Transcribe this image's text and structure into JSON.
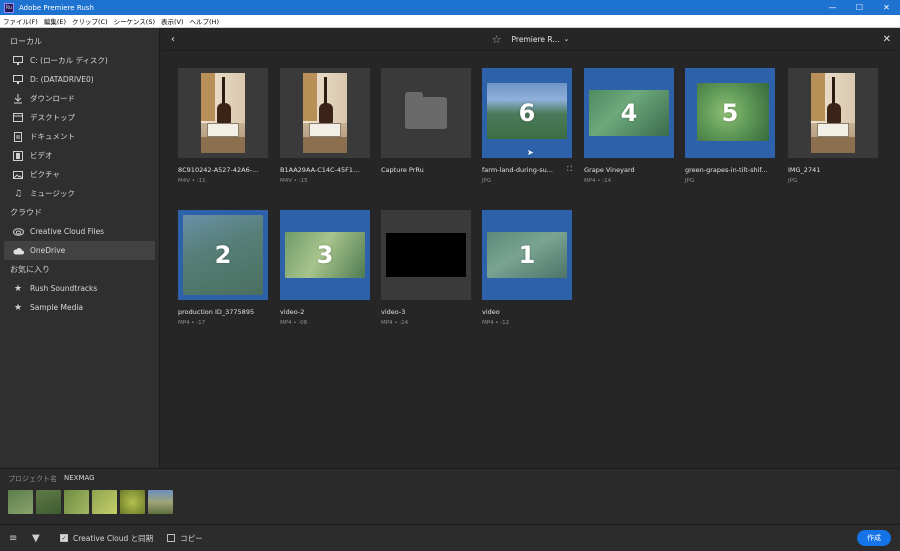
{
  "window": {
    "title": "Adobe Premiere Rush",
    "icon_text": "Ru",
    "controls": [
      "—",
      "☐",
      "✕"
    ]
  },
  "menubar": [
    "ファイル(F)",
    "編集(E)",
    "クリップ(C)",
    "シーケンス(S)",
    "表示(V)",
    "ヘルプ(H)"
  ],
  "sidebar": {
    "sections": [
      {
        "title": "ローカル",
        "items": [
          {
            "label": "C: (ローカル ディスク)",
            "icon": "monitor-icon"
          },
          {
            "label": "D: (DATADRIVE0)",
            "icon": "monitor-icon"
          },
          {
            "label": "ダウンロード",
            "icon": "download-icon"
          },
          {
            "label": "デスクトップ",
            "icon": "desktop-icon"
          },
          {
            "label": "ドキュメント",
            "icon": "document-icon"
          },
          {
            "label": "ビデオ",
            "icon": "film-icon"
          },
          {
            "label": "ピクチャ",
            "icon": "image-icon"
          },
          {
            "label": "ミュージック",
            "icon": "music-icon"
          }
        ]
      },
      {
        "title": "クラウド",
        "items": [
          {
            "label": "Creative Cloud Files",
            "icon": "creative-cloud-icon"
          },
          {
            "label": "OneDrive",
            "icon": "cloud-icon",
            "active": true
          }
        ]
      },
      {
        "title": "お気に入り",
        "items": [
          {
            "label": "Rush Soundtracks",
            "icon": "star-icon"
          },
          {
            "label": "Sample Media",
            "icon": "star-icon"
          }
        ]
      }
    ]
  },
  "topnav": {
    "location": "Premiere R...",
    "back": "‹",
    "close": "✕",
    "star": "☆",
    "caret": "⌄"
  },
  "files": [
    {
      "name": "8C910242-A527-42A6-...",
      "meta": "M4V • :11",
      "kind": "guitar"
    },
    {
      "name": "B1AA29AA-C14C-45F1...",
      "meta": "M4V • :15",
      "kind": "guitar"
    },
    {
      "name": "Capture PrRu",
      "meta": "",
      "kind": "folder"
    },
    {
      "name": "farm-land-during-su...",
      "meta": "JPG",
      "kind": "farm",
      "selected": true,
      "order": "6"
    },
    {
      "name": "Grape Vineyard",
      "meta": "MP4 • :14",
      "kind": "vineyard",
      "selected": true,
      "order": "4"
    },
    {
      "name": "green-grapes-in-tilt-shif...",
      "meta": "JPG",
      "kind": "grapes",
      "selected": true,
      "order": "5"
    },
    {
      "name": "IMG_2741",
      "meta": "JPG",
      "kind": "guitar"
    },
    {
      "name": "production ID_3775895",
      "meta": "MP4 • :17",
      "kind": "field",
      "selected": true,
      "order": "2"
    },
    {
      "name": "video-2",
      "meta": "MP4 • :08",
      "kind": "grapes2",
      "selected": true,
      "order": "3"
    },
    {
      "name": "video-3",
      "meta": "MP4 • :24",
      "kind": "black"
    },
    {
      "name": "video",
      "meta": "MP4 • :12",
      "kind": "road",
      "selected": true,
      "order": "1"
    }
  ],
  "project": {
    "label": "プロジェクト名",
    "name": "NEXMAG"
  },
  "footer": {
    "sync_label": "Creative Cloud と同期",
    "copy_label": "コピー",
    "create_label": "作成",
    "sync_checked": true,
    "copy_checked": false
  },
  "colors": {
    "accent": "#1473e6",
    "selection": "#2d62ab",
    "titlebar": "#1e73d0"
  }
}
